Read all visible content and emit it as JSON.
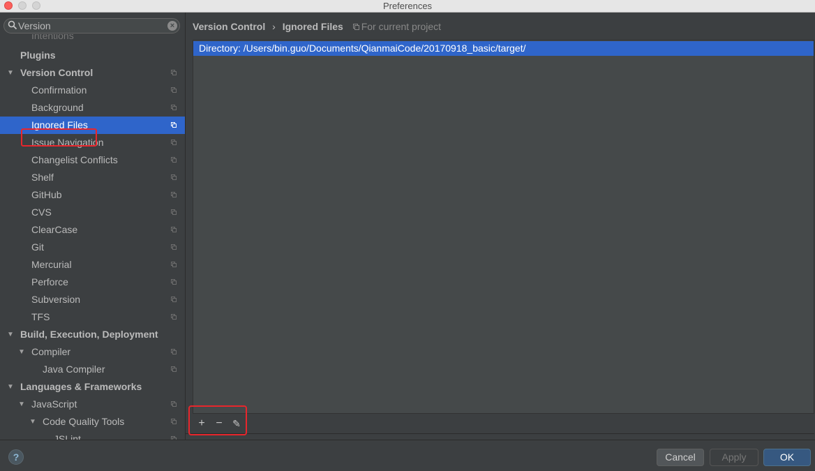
{
  "window": {
    "title": "Preferences"
  },
  "search": {
    "value": "Version",
    "placeholder": ""
  },
  "partial_item": "Intentions",
  "sidebar": {
    "items": [
      {
        "label": "Plugins",
        "level": 0,
        "bold": true,
        "arrow": "",
        "copy": false
      },
      {
        "label": "Version Control",
        "level": 0,
        "bold": true,
        "arrow": "▼",
        "copy": true
      },
      {
        "label": "Confirmation",
        "level": 1,
        "bold": false,
        "arrow": "",
        "copy": true
      },
      {
        "label": "Background",
        "level": 1,
        "bold": false,
        "arrow": "",
        "copy": true
      },
      {
        "label": "Ignored Files",
        "level": 1,
        "bold": false,
        "arrow": "",
        "copy": true,
        "selected": true
      },
      {
        "label": "Issue Navigation",
        "level": 1,
        "bold": false,
        "arrow": "",
        "copy": true
      },
      {
        "label": "Changelist Conflicts",
        "level": 1,
        "bold": false,
        "arrow": "",
        "copy": true
      },
      {
        "label": "Shelf",
        "level": 1,
        "bold": false,
        "arrow": "",
        "copy": true
      },
      {
        "label": "GitHub",
        "level": 1,
        "bold": false,
        "arrow": "",
        "copy": true
      },
      {
        "label": "CVS",
        "level": 1,
        "bold": false,
        "arrow": "",
        "copy": true
      },
      {
        "label": "ClearCase",
        "level": 1,
        "bold": false,
        "arrow": "",
        "copy": true
      },
      {
        "label": "Git",
        "level": 1,
        "bold": false,
        "arrow": "",
        "copy": true
      },
      {
        "label": "Mercurial",
        "level": 1,
        "bold": false,
        "arrow": "",
        "copy": true
      },
      {
        "label": "Perforce",
        "level": 1,
        "bold": false,
        "arrow": "",
        "copy": true
      },
      {
        "label": "Subversion",
        "level": 1,
        "bold": false,
        "arrow": "",
        "copy": true
      },
      {
        "label": "TFS",
        "level": 1,
        "bold": false,
        "arrow": "",
        "copy": true
      },
      {
        "label": "Build, Execution, Deployment",
        "level": 0,
        "bold": true,
        "arrow": "▼",
        "copy": false
      },
      {
        "label": "Compiler",
        "level": 1,
        "bold": false,
        "arrow": "▼",
        "copy": true
      },
      {
        "label": "Java Compiler",
        "level": 2,
        "bold": false,
        "arrow": "",
        "copy": true
      },
      {
        "label": "Languages & Frameworks",
        "level": 0,
        "bold": true,
        "arrow": "▼",
        "copy": false
      },
      {
        "label": "JavaScript",
        "level": 1,
        "bold": false,
        "arrow": "▼",
        "copy": true
      },
      {
        "label": "Code Quality Tools",
        "level": 2,
        "bold": false,
        "arrow": "▼",
        "copy": true
      },
      {
        "label": "JSLint",
        "level": 3,
        "bold": false,
        "arrow": "",
        "copy": true
      }
    ]
  },
  "breadcrumb": {
    "parent": "Version Control",
    "separator": "›",
    "current": "Ignored Files",
    "scope": "For current project"
  },
  "ignored_list": [
    "Directory: /Users/bin.guo/Documents/QianmaiCode/20170918_basic/target/"
  ],
  "toolbar": {
    "add": "+",
    "remove": "−",
    "edit": "✎"
  },
  "buttons": {
    "help": "?",
    "cancel": "Cancel",
    "apply": "Apply",
    "ok": "OK"
  },
  "colors": {
    "selection": "#2f65ca",
    "highlight": "#e8262c",
    "background": "#3c3f41"
  }
}
